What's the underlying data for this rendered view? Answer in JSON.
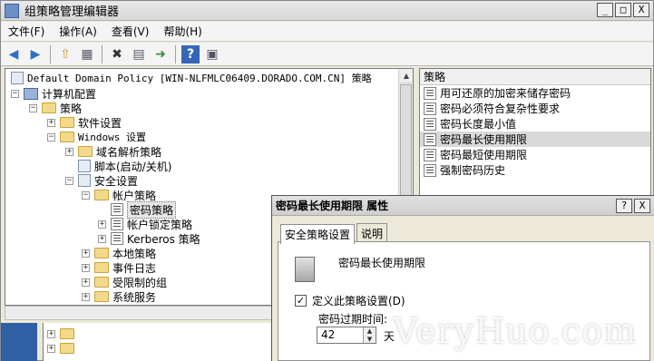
{
  "window": {
    "title": "组策略管理编辑器"
  },
  "window_buttons": {
    "minimize": "_",
    "maximize": "□",
    "close": "X"
  },
  "menu": [
    "文件(F)",
    "操作(A)",
    "查看(V)",
    "帮助(H)"
  ],
  "toolbar": {
    "icons": [
      "back-icon",
      "forward-icon",
      "up-icon",
      "show-hide-tree-icon",
      "delete-icon",
      "properties-icon",
      "export-icon",
      "help-icon",
      "view-icon"
    ],
    "glyphs": [
      "◀",
      "▶",
      "⇧",
      "▦",
      "✖",
      "▤",
      "➜",
      "?",
      "▣"
    ]
  },
  "tree": {
    "root": "Default Domain Policy [WIN-NLFMLC06409.DORADO.COM.CN] 策略",
    "computer_config": "计算机配置",
    "policies": "策略",
    "software_settings": "软件设置",
    "windows_settings": "Windows 设置",
    "name_resolution": "域名解析策略",
    "scripts": "脚本(启动/关机)",
    "security_settings": "安全设置",
    "account_policies": "帐户策略",
    "password_policy": "密码策略",
    "lockout_policy": "帐户锁定策略",
    "kerberos_policy": "Kerberos 策略",
    "local_policies": "本地策略",
    "event_log": "事件日志",
    "restricted_groups": "受限制的组",
    "system_services": "系统服务",
    "expander_plus": "+",
    "expander_minus": "−"
  },
  "right_pane": {
    "column_header": "策略",
    "items": [
      "用可还原的加密来储存密码",
      "密码必须符合复杂性要求",
      "密码长度最小值",
      "密码最长使用期限",
      "密码最短使用期限",
      "强制密码历史"
    ],
    "selected_index": 3
  },
  "dialog": {
    "title": "密码最长使用期限 属性",
    "help_button": "?",
    "close_button": "X",
    "tabs": [
      "安全策略设置",
      "说明"
    ],
    "policy_name": "密码最长使用期限",
    "checkbox_label": "定义此策略设置(D)",
    "checkbox_checked": true,
    "checkbox_mark": "✓",
    "expire_label": "密码过期时间:",
    "expire_value": "42",
    "expire_unit": "天"
  },
  "scroll": {
    "up": "▲",
    "down": "▼"
  },
  "watermark": "VeryHuo.com"
}
